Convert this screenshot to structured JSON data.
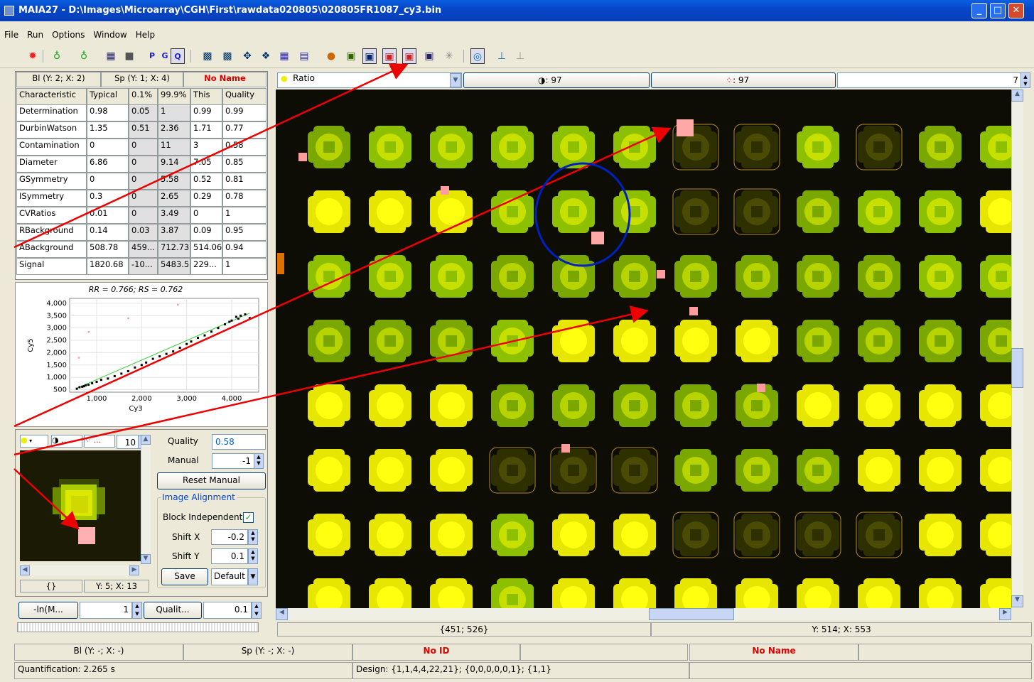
{
  "window": {
    "title": "MAIA27 - D:\\Images\\Microarray\\CGH\\First\\rawdata020805\\020805FR1087_cy3.bin"
  },
  "menu": [
    "File",
    "Run",
    "Options",
    "Window",
    "Help"
  ],
  "table": {
    "block_label": "Bl (Y: 2; X: 2)",
    "spot_label": "Sp (Y: 1; X: 4)",
    "name_label": "No Name",
    "headers": [
      "Characteristic",
      "Typical",
      "0.1%",
      "99.9%",
      "This",
      "Quality"
    ],
    "rows": [
      [
        "Determination",
        "0.98",
        "0.05",
        "1",
        "0.99",
        "0.99"
      ],
      [
        "DurbinWatson",
        "1.35",
        "0.51",
        "2.36",
        "1.71",
        "0.77"
      ],
      [
        "Contamination",
        "0",
        "0",
        "11",
        "3",
        "0.58"
      ],
      [
        "Diameter",
        "6.86",
        "0",
        "9.14",
        "7.05",
        "0.85"
      ],
      [
        "GSymmetry",
        "0",
        "0",
        "5.58",
        "0.52",
        "0.81"
      ],
      [
        "ISymmetry",
        "0.3",
        "0",
        "2.65",
        "0.29",
        "0.78"
      ],
      [
        "CVRatios",
        "0.01",
        "0",
        "3.49",
        "0",
        "1"
      ],
      [
        "RBackground",
        "0.14",
        "0.03",
        "3.87",
        "0.09",
        "0.95"
      ],
      [
        "ABackground",
        "508.78",
        "459...",
        "712.73",
        "514.06",
        "0.94"
      ],
      [
        "Signal",
        "1820.68",
        "-10...",
        "5483.5",
        "229...",
        "1"
      ]
    ]
  },
  "chart_data": {
    "type": "scatter",
    "title": "RR = 0.766; RS = 0.762",
    "xlabel": "Cy3",
    "ylabel": "Cy5",
    "xticks": [
      "1,000",
      "2,000",
      "3,000",
      "4,000"
    ],
    "yticks": [
      "4,000",
      "3,500",
      "3,000",
      "2,500",
      "2,000",
      "1,500",
      "1,000",
      "500"
    ],
    "xlim": [
      400,
      4600
    ],
    "ylim": [
      400,
      4200
    ],
    "points": [
      [
        560,
        540
      ],
      [
        620,
        600
      ],
      [
        680,
        620
      ],
      [
        720,
        640
      ],
      [
        760,
        680
      ],
      [
        820,
        700
      ],
      [
        900,
        760
      ],
      [
        1000,
        820
      ],
      [
        1100,
        900
      ],
      [
        1250,
        950
      ],
      [
        1400,
        1050
      ],
      [
        1550,
        1150
      ],
      [
        1700,
        1250
      ],
      [
        1850,
        1400
      ],
      [
        2000,
        1500
      ],
      [
        2100,
        1600
      ],
      [
        2250,
        1750
      ],
      [
        2400,
        1850
      ],
      [
        2550,
        1950
      ],
      [
        2700,
        2050
      ],
      [
        2850,
        2200
      ],
      [
        3000,
        2350
      ],
      [
        3100,
        2450
      ],
      [
        3250,
        2600
      ],
      [
        3400,
        2700
      ],
      [
        3550,
        2850
      ],
      [
        3700,
        3000
      ],
      [
        3850,
        3150
      ],
      [
        4000,
        3300
      ],
      [
        4100,
        3450
      ],
      [
        4200,
        3500
      ],
      [
        4300,
        3550
      ],
      [
        4400,
        3400
      ],
      [
        4150,
        3380
      ],
      [
        3950,
        3250
      ]
    ],
    "outliers": [
      [
        1700,
        3400
      ],
      [
        2800,
        3950
      ],
      [
        600,
        1800
      ],
      [
        820,
        2850
      ]
    ],
    "fit": [
      [
        560,
        560
      ],
      [
        4400,
        3600
      ]
    ],
    "colors": {
      "points": "#000000",
      "outliers": "#ff9999",
      "fit": "#33cc33"
    }
  },
  "spot_panel": {
    "selector_value": "10",
    "quality_label": "Quality",
    "quality_value": "0.58",
    "manual_label": "Manual",
    "manual_value": "-1",
    "reset_label": "Reset Manual",
    "align_title": "Image Alignment",
    "block_indep_label": "Block Independent",
    "shiftx_label": "Shift X",
    "shiftx_value": "-0.2",
    "shifty_label": "Shift Y",
    "shifty_value": "0.1",
    "save_label": "Save",
    "default_label": "Default",
    "braces": "{}",
    "pos": "Y: 5; X: 13"
  },
  "filter": {
    "mode_label": "-ln(M...",
    "mode_value": "1",
    "qual_label": "Qualit...",
    "qual_value": "0.1"
  },
  "view": {
    "channel_label": "Ratio",
    "count1": ": 97",
    "count2": ": 97",
    "zoom": "7",
    "coord1": "{451; 526}",
    "coord2": "Y: 514; X: 553"
  },
  "status": {
    "block": "Bl (Y: -; X: -)",
    "spot": "Sp (Y: -; X: -)",
    "no_id": "No ID",
    "no_name": "No Name",
    "quant": "Quantification: 2.265 s",
    "design": "Design: {1,1,4,4,22,21}; {0,0,0,0,0,1}; {1,1}"
  }
}
